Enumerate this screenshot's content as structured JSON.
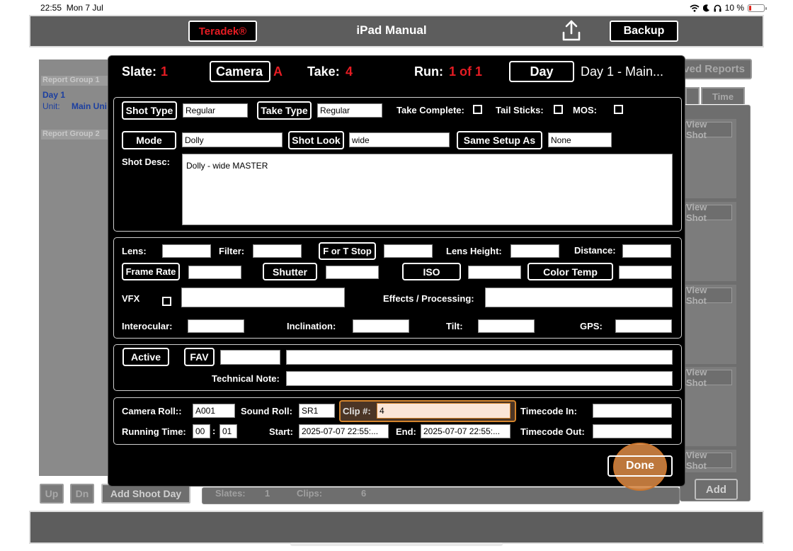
{
  "status_bar": {
    "time": "22:55",
    "date": "Mon 7 Jul",
    "battery": "10 %"
  },
  "top_bar": {
    "teradek_label": "Teradek®",
    "title": "iPad Manual",
    "backup_label": "Backup"
  },
  "background": {
    "report_group_1": "Report Group 1",
    "day_label": "Day 1",
    "unit_label": "Unit:",
    "unit_value": "Main Uni",
    "report_group_2": "Report Group 2",
    "saved_reports": "ved Reports",
    "time_tab": "Time",
    "view_shot": "View Shot",
    "slates_label": "Slates:",
    "slates_value": "1",
    "clips_label": "Clips:",
    "clips_value": "6",
    "up_label": "Up",
    "dn_label": "Dn",
    "add_shoot_day": "Add Shoot Day",
    "add_label": "Add"
  },
  "header": {
    "slate_label": "Slate:",
    "slate_value": "1",
    "camera_label": "Camera",
    "camera_value": "A",
    "take_label": "Take:",
    "take_value": "4",
    "run_label": "Run:",
    "run_value": "1 of 1",
    "day_button": "Day",
    "day_value": "Day 1 - Main..."
  },
  "shot_section": {
    "shot_type_label": "Shot Type",
    "shot_type_value": "Regular",
    "take_type_label": "Take Type",
    "take_type_value": "Regular",
    "take_complete_label": "Take Complete:",
    "tail_sticks_label": "Tail Sticks:",
    "mos_label": "MOS:",
    "mode_label": "Mode",
    "mode_value": "Dolly",
    "shot_look_label": "Shot Look",
    "shot_look_value": "wide",
    "same_setup_label": "Same Setup As",
    "same_setup_value": "None",
    "shot_desc_label": "Shot Desc:",
    "shot_desc_value": "Dolly - wide MASTER"
  },
  "camera_section": {
    "lens_label": "Lens:",
    "lens_value": "",
    "filter_label": "Filter:",
    "filter_value": "",
    "stop_label": "F or T Stop",
    "stop_value": "",
    "lens_height_label": "Lens Height:",
    "lens_height_value": "",
    "distance_label": "Distance:",
    "distance_value": "",
    "frame_rate_label": "Frame Rate",
    "frame_rate_value": "",
    "shutter_label": "Shutter",
    "shutter_value": "",
    "iso_label": "ISO",
    "iso_value": "",
    "color_temp_label": "Color Temp",
    "color_temp_value": "",
    "vfx_label": "VFX",
    "vfx_value": "",
    "effects_label": "Effects / Processing:",
    "effects_value": "",
    "interocular_label": "Interocular:",
    "interocular_value": "",
    "inclination_label": "Inclination:",
    "inclination_value": "",
    "tilt_label": "Tilt:",
    "tilt_value": "",
    "gps_label": "GPS:",
    "gps_value": ""
  },
  "notes_section": {
    "active_label": "Active",
    "fav_label": "FAV",
    "fav_value": "",
    "note_value": "",
    "technical_note_label": "Technical Note:",
    "technical_note_value": ""
  },
  "roll_section": {
    "camera_roll_label": "Camera Roll::",
    "camera_roll_value": "A001",
    "sound_roll_label": "Sound Roll:",
    "sound_roll_value": "SR1",
    "clip_label": "Clip #:",
    "clip_value": "4",
    "timecode_in_label": "Timecode In:",
    "timecode_in_value": "",
    "running_time_label": "Running Time:",
    "running_time_min": "00",
    "running_time_sep": ":",
    "running_time_sec": "01",
    "start_label": "Start:",
    "start_value": "2025-07-07 22:55:...",
    "end_label": "End:",
    "end_value": "2025-07-07 22:55:...",
    "timecode_out_label": "Timecode Out:",
    "timecode_out_value": ""
  },
  "done_label": "Done",
  "colors": {
    "accent_red": "#e51c23",
    "highlight_orange": "#d4842c"
  }
}
